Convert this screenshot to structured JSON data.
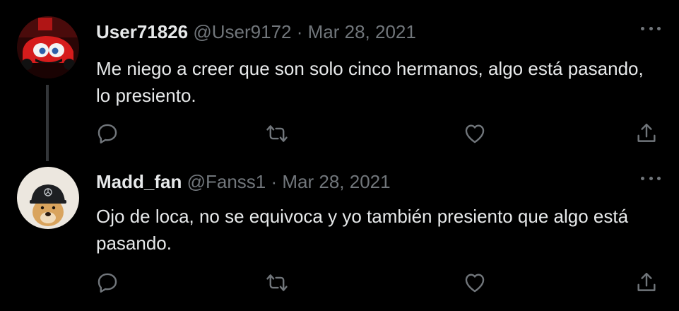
{
  "tweets": [
    {
      "name": "User71826",
      "handle": "@User9172",
      "dot": "·",
      "date": "Mar 28, 2021",
      "text": "Me niego a creer que son solo cinco hermanos, algo está pasando, lo presiento.",
      "avatar_icon": "cartoon-race-car-avatar"
    },
    {
      "name": "Madd_fan",
      "handle": "@Fanss1",
      "dot": "·",
      "date": "Mar 28, 2021",
      "text": "Ojo de loca, no se equivoca y yo también presiento que algo está pasando.",
      "avatar_icon": "dog-with-cap-avatar"
    }
  ],
  "colors": {
    "background": "#000000",
    "text": "#e7e9ea",
    "secondary": "#71767b",
    "thread_line": "#333639"
  }
}
